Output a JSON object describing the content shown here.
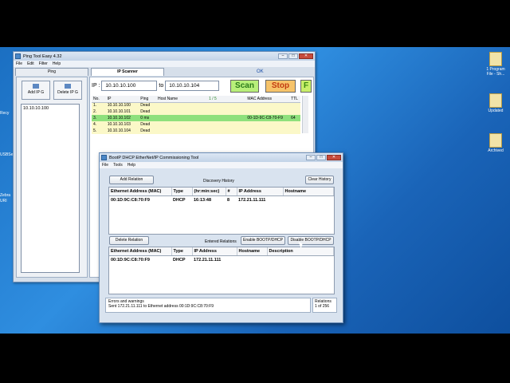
{
  "desktop": {
    "left_labels": [
      "Recy",
      "USBSe",
      "Zebra",
      "URI"
    ],
    "right_icons": [
      {
        "name": "1 Program File - Sh...",
        "lines": [
          "1 Program",
          "File - Sh..."
        ]
      },
      {
        "name": "Updated",
        "lines": [
          "Updated"
        ]
      },
      {
        "name": "Archived",
        "lines": [
          "Archived"
        ]
      }
    ]
  },
  "ping_window": {
    "title": "Ping Tool Easy 4.32",
    "menu": [
      "File",
      "Edit",
      "Filter",
      "Help"
    ],
    "tabs": [
      {
        "label": "Ping",
        "active": false
      },
      {
        "label": "IP Scanner",
        "active": true
      }
    ],
    "ok_label": "OK",
    "add_ip_label": "Add IP G",
    "delete_ip_label": "Delete IP G",
    "ip_list": [
      "10.10.10.100"
    ],
    "ip_prefix": "IP :",
    "ip_from": "10.10.10.100",
    "ip_to_label": "to",
    "ip_to": "10.10.10.104",
    "scan_label": "Scan",
    "stop_label": "Stop",
    "f_label": "F",
    "columns": [
      "No.",
      "IP",
      "Ping",
      "Host Name",
      "1 / 5",
      "MAC Address",
      "TTL"
    ],
    "rows": [
      {
        "no": "1.",
        "ip": "10.10.10.100",
        "ping": "Dead",
        "host": "",
        "mac": "",
        "ttl": "",
        "status": "dead"
      },
      {
        "no": "2.",
        "ip": "10.10.10.101",
        "ping": "Dead",
        "host": "",
        "mac": "",
        "ttl": "",
        "status": "dead"
      },
      {
        "no": "3.",
        "ip": "10.10.10.102",
        "ping": "0 ms",
        "host": "",
        "mac": "00-1D-9C-C8-70-F9",
        "ttl": "64",
        "status": "alive"
      },
      {
        "no": "4.",
        "ip": "10.10.10.103",
        "ping": "Dead",
        "host": "",
        "mac": "",
        "ttl": "",
        "status": "dead"
      },
      {
        "no": "5.",
        "ip": "10.10.10.104",
        "ping": "Dead",
        "host": "",
        "mac": "",
        "ttl": "",
        "status": "dead"
      }
    ]
  },
  "bootp_window": {
    "title": "BootP DHCP EtherNet/IP Commissioning Tool",
    "menu": [
      "File",
      "Tools",
      "Help"
    ],
    "add_relation_label": "Add Relation",
    "discovery_history_label": "Discovery History",
    "clear_history_label": "Clear History",
    "history_columns": [
      "Ethernet Address (MAC)",
      "Type",
      "(hr:min:sec)",
      "#",
      "IP Address",
      "Hostname"
    ],
    "history_rows": [
      {
        "mac": "00:1D:9C:C8:70:F9",
        "type": "DHCP",
        "time": "16:13:48",
        "count": "8",
        "ip": "172.21.11.111",
        "hostname": ""
      }
    ],
    "delete_relation_label": "Delete Relation",
    "entered_relations_label": "Entered Relations",
    "enable_bootp_label": "Enable BOOTP/DHCP",
    "disable_bootp_label": "Disable BOOTP/DHCP",
    "relation_columns": [
      "Ethernet Address (MAC)",
      "Type",
      "IP Address",
      "Hostname",
      "Description"
    ],
    "relation_rows": [
      {
        "mac": "00:1D:9C:C8:70:F9",
        "type": "DHCP",
        "ip": "172.21.11.111",
        "hostname": "",
        "description": ""
      }
    ],
    "errors_label": "Errors and warnings",
    "errors_text": "Sent 172.21.11.111 to Ethernet address 00:1D:9C:C8:70:F9",
    "relations_label": "Relations",
    "relations_value": "1 of 256"
  }
}
